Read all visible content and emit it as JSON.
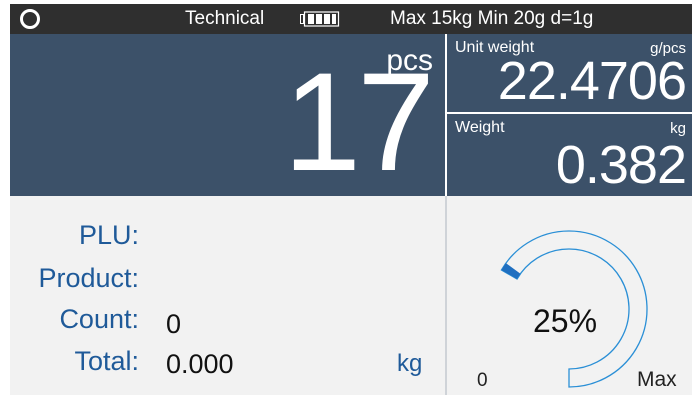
{
  "topbar": {
    "mode": "Technical",
    "spec": "Max 15kg Min 20g d=1g",
    "battery_level": 0.8
  },
  "count_display": {
    "unit": "pcs",
    "value": "17"
  },
  "unit_weight": {
    "label": "Unit weight",
    "unit": "g/pcs",
    "value": "22.4706"
  },
  "weight": {
    "label": "Weight",
    "unit": "kg",
    "value": "0.382"
  },
  "info": {
    "plu_label": "PLU:",
    "product_label": "Product:",
    "count_label": "Count:",
    "count_value": "0",
    "total_label": "Total:",
    "total_value": "0.000",
    "total_unit": "kg"
  },
  "gauge": {
    "percent_text": "25%",
    "level": 0.025,
    "min_label": "0",
    "max_label": "Max",
    "track_color": "#2a8fd6",
    "fill_color": "#1f6fc0"
  },
  "colors": {
    "panel": "#3c5169",
    "topbar": "#2f2f2f",
    "label_blue": "#1f5a99"
  }
}
